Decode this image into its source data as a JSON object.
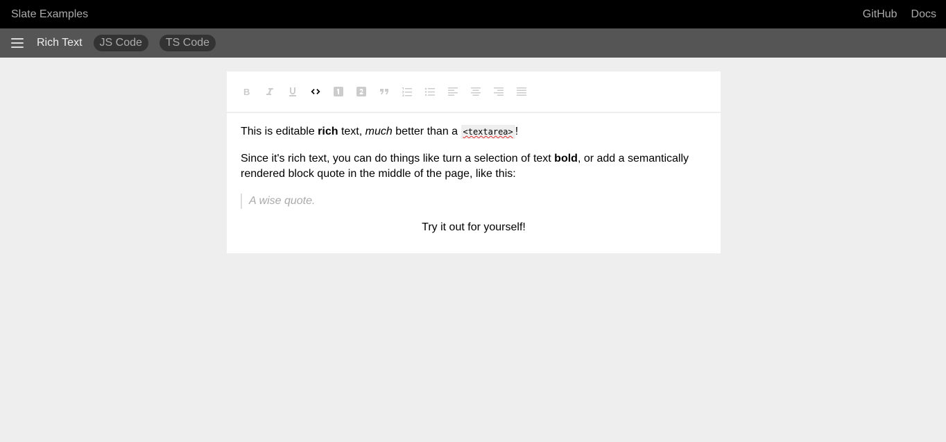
{
  "header": {
    "title": "Slate Examples",
    "links": [
      "GitHub",
      "Docs"
    ]
  },
  "subheader": {
    "example": "Rich Text",
    "pills": [
      "JS Code",
      "TS Code"
    ]
  },
  "toolbar": {
    "buttons": [
      {
        "icon": "bold-icon",
        "active": false
      },
      {
        "icon": "italic-icon",
        "active": false
      },
      {
        "icon": "underline-icon",
        "active": false
      },
      {
        "icon": "code-icon",
        "active": true
      },
      {
        "icon": "heading-one-icon",
        "active": false
      },
      {
        "icon": "heading-two-icon",
        "active": false
      },
      {
        "icon": "quote-icon",
        "active": false
      },
      {
        "icon": "numbered-list-icon",
        "active": false
      },
      {
        "icon": "bulleted-list-icon",
        "active": false
      },
      {
        "icon": "align-left-icon",
        "active": false
      },
      {
        "icon": "align-center-icon",
        "active": false
      },
      {
        "icon": "align-right-icon",
        "active": false
      },
      {
        "icon": "align-justify-icon",
        "active": false
      }
    ]
  },
  "document": {
    "p1": {
      "a": "This is editable ",
      "b": "rich",
      "c": " text, ",
      "d": "much",
      "e": " better than a ",
      "code": "<textarea>",
      "f": "!"
    },
    "p2": {
      "a": "Since it's rich text, you can do things like turn a selection of text ",
      "b": "bold",
      "c": ", or add a semantically rendered block quote in the middle of the page, like this:"
    },
    "quote": "A wise quote.",
    "p3": "Try it out for yourself!"
  },
  "colors": {
    "topbar": "#000000",
    "subbar": "#555555",
    "background": "#eeeeee",
    "active_icon": "#000000",
    "inactive_icon": "#cccccc"
  }
}
